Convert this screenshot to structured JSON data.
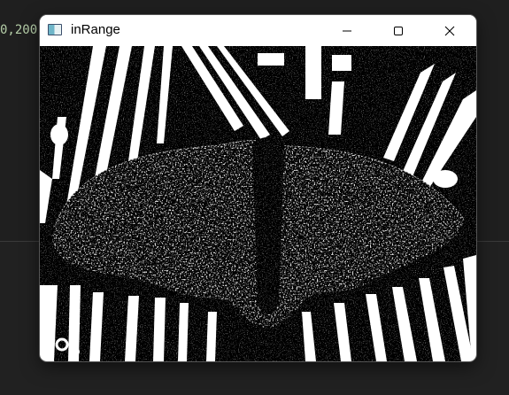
{
  "editor": {
    "code_fragment": "0,200"
  },
  "window": {
    "title": "inRange",
    "icon": "opencv-window-icon",
    "controls": {
      "minimize": "minimize-icon",
      "maximize": "maximize-icon",
      "close": "close-icon"
    },
    "image": {
      "description_kind": "binary thresholded photograph (black and white butterfly on striped leaf)"
    }
  }
}
